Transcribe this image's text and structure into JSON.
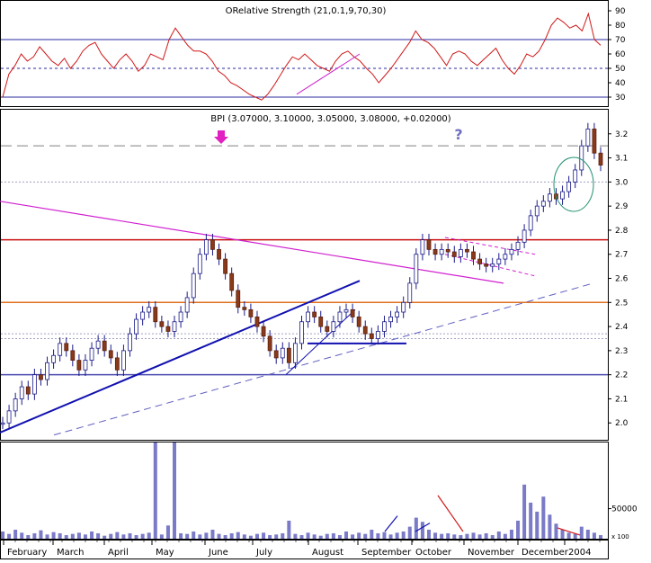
{
  "chart_data": [
    {
      "type": "line",
      "panel": "rsi",
      "title": "ORelative Strength (21,0.1,9,70,30)",
      "y_ticks": [
        30,
        40,
        50,
        60,
        70,
        80,
        90
      ],
      "ylim": [
        25,
        95
      ],
      "reference_levels": [
        {
          "value": 70,
          "style": "solid",
          "color": "#2a2aa0"
        },
        {
          "value": 50,
          "style": "dotted",
          "color": "#2a2aa0"
        },
        {
          "value": 30,
          "style": "solid",
          "color": "#2a2aa0"
        }
      ],
      "series": [
        {
          "color": "#d01818",
          "values": [
            30,
            46,
            52,
            60,
            55,
            58,
            65,
            60,
            55,
            52,
            57,
            50,
            55,
            62,
            66,
            68,
            60,
            55,
            50,
            56,
            60,
            55,
            48,
            52,
            60,
            58,
            56,
            70,
            78,
            72,
            66,
            62,
            62,
            60,
            55,
            48,
            45,
            40,
            38,
            35,
            32,
            30,
            28,
            32,
            38,
            45,
            52,
            58,
            56,
            60,
            56,
            52,
            50,
            48,
            55,
            60,
            62,
            58,
            55,
            50,
            46,
            40,
            45,
            50,
            56,
            62,
            68,
            76,
            70,
            68,
            64,
            58,
            52,
            60,
            62,
            60,
            55,
            52,
            56,
            60,
            64,
            56,
            50,
            46,
            52,
            60,
            58,
            62,
            70,
            80,
            85,
            82,
            78,
            80,
            76,
            88,
            70,
            66
          ]
        }
      ],
      "annotation_lines": [
        {
          "color": "#d020d0",
          "from_value": 32,
          "to_value": 60
        }
      ]
    },
    {
      "type": "candlestick",
      "panel": "price",
      "title": "BPI (3.07000, 3.10000, 3.05000, 3.08000, +0.02000)",
      "y_ticks": [
        2.0,
        2.1,
        2.2,
        2.3,
        2.4,
        2.5,
        2.6,
        2.7,
        2.8,
        2.9,
        3.0,
        3.1,
        3.2
      ],
      "ylim": [
        1.93,
        3.3
      ],
      "x_tick_labels": [
        "February",
        "March",
        "April",
        "May",
        "June",
        "July",
        "August",
        "September",
        "October",
        "November",
        "December",
        "2004"
      ],
      "series": [
        {
          "name": "BPI",
          "color": "#1a1a8a",
          "values": [
            2.0,
            2.05,
            2.1,
            2.15,
            2.12,
            2.2,
            2.18,
            2.25,
            2.28,
            2.33,
            2.3,
            2.26,
            2.22,
            2.26,
            2.31,
            2.34,
            2.3,
            2.27,
            2.22,
            2.3,
            2.37,
            2.43,
            2.46,
            2.48,
            2.42,
            2.4,
            2.38,
            2.42,
            2.46,
            2.52,
            2.62,
            2.7,
            2.76,
            2.72,
            2.68,
            2.62,
            2.55,
            2.48,
            2.47,
            2.44,
            2.4,
            2.36,
            2.3,
            2.27,
            2.31,
            2.25,
            2.33,
            2.42,
            2.46,
            2.44,
            2.4,
            2.38,
            2.42,
            2.46,
            2.47,
            2.44,
            2.4,
            2.37,
            2.35,
            2.38,
            2.42,
            2.44,
            2.46,
            2.5,
            2.58,
            2.7,
            2.76,
            2.72,
            2.7,
            2.72,
            2.71,
            2.69,
            2.72,
            2.71,
            2.68,
            2.66,
            2.65,
            2.66,
            2.68,
            2.7,
            2.72,
            2.75,
            2.8,
            2.86,
            2.9,
            2.92,
            2.95,
            2.93,
            2.96,
            3.0,
            3.05,
            3.15,
            3.22,
            3.12,
            3.07
          ]
        }
      ],
      "horizontal_levels": [
        {
          "value": 2.76,
          "color": "#c81010"
        },
        {
          "value": 2.5,
          "color": "#e07020"
        },
        {
          "value": 2.2,
          "color": "#4a4ab0"
        },
        {
          "value": 3.15,
          "color": "#808080",
          "style": "dashed"
        },
        {
          "value": 3.0,
          "color": "#a0a0c0",
          "style": "dotted"
        },
        {
          "value": 2.37,
          "color": "#a0a0c0",
          "style": "dotted"
        },
        {
          "value": 2.35,
          "color": "#a0a0c0",
          "style": "dotted"
        }
      ],
      "annotations": [
        "?"
      ]
    },
    {
      "type": "bar",
      "panel": "volume",
      "y_ticks": [
        50000
      ],
      "y_tick_labels": [
        "50000"
      ],
      "ylim": [
        0,
        160000
      ],
      "corner_label": "x 100",
      "series": [
        {
          "color": "#7a7ac8",
          "values": [
            12000,
            8000,
            15000,
            10000,
            6000,
            9000,
            14000,
            7000,
            11000,
            9000,
            6000,
            8000,
            10000,
            7000,
            12000,
            9000,
            5000,
            8000,
            11000,
            7000,
            9000,
            6000,
            8000,
            10000,
            160000,
            7000,
            22000,
            160000,
            9000,
            8000,
            12000,
            7000,
            10000,
            15000,
            8000,
            6000,
            9000,
            11000,
            7000,
            5000,
            8000,
            10000,
            6000,
            7000,
            9000,
            30000,
            8000,
            6000,
            10000,
            7000,
            5000,
            8000,
            9000,
            6000,
            12000,
            7000,
            10000,
            8000,
            15000,
            9000,
            11000,
            7000,
            10000,
            12000,
            20000,
            35000,
            28000,
            15000,
            10000,
            8000,
            9000,
            7000,
            6000,
            8000,
            10000,
            7000,
            9000,
            6000,
            12000,
            8000,
            15000,
            30000,
            90000,
            60000,
            45000,
            70000,
            40000,
            25000,
            15000,
            10000,
            8000,
            20000,
            15000,
            10000,
            6000
          ]
        }
      ]
    }
  ]
}
